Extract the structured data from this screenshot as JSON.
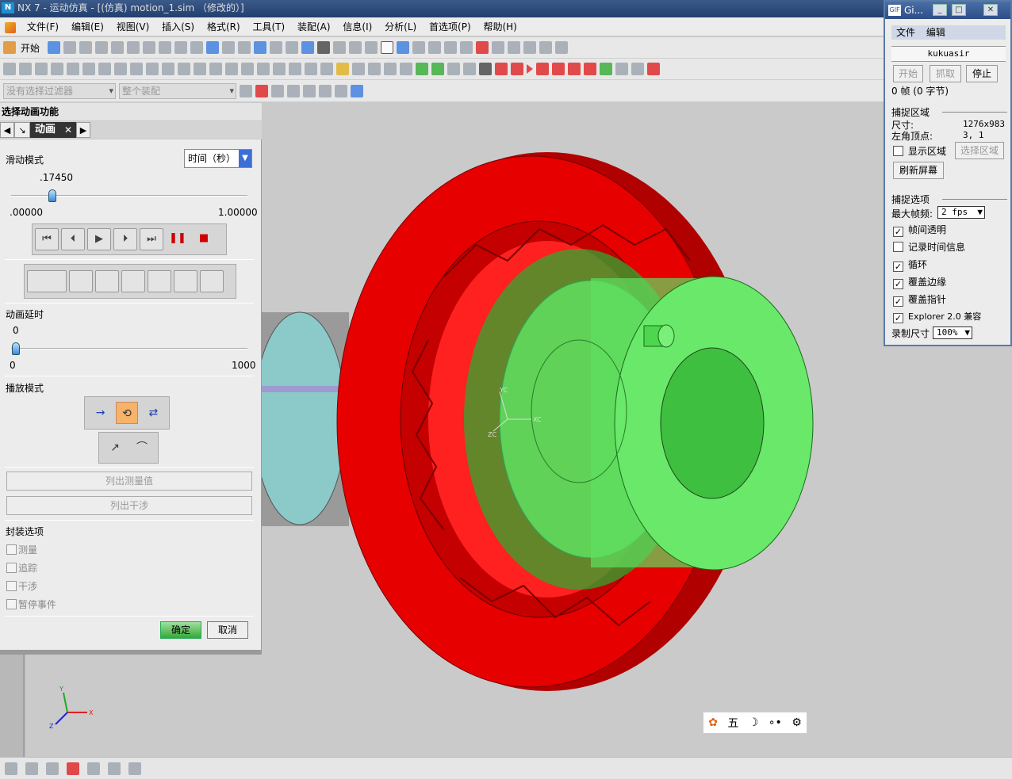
{
  "window": {
    "title": "NX 7 - 运动仿真 - [(仿真) motion_1.sim （修改的）]"
  },
  "menu": [
    "文件(F)",
    "编辑(E)",
    "视图(V)",
    "插入(S)",
    "格式(R)",
    "工具(T)",
    "装配(A)",
    "信息(I)",
    "分析(L)",
    "首选项(P)",
    "帮助(H)"
  ],
  "toolbar": {
    "start_label": "开始",
    "filter_placeholder": "没有选择过滤器",
    "assembly_placeholder": "整个装配"
  },
  "dialog": {
    "title": "选择动画功能",
    "tab_label": "动画",
    "slide_mode_label": "滑动模式",
    "slide_mode_value": "时间（秒）",
    "slider_value": ".17450",
    "slider_min": ".00000",
    "slider_max": "1.00000",
    "slider_fraction": 0.1745,
    "delay_label": "动画延时",
    "delay_value": "0",
    "delay_min": "0",
    "delay_max": "1000",
    "play_mode_label": "播放模式",
    "list_measure_label": "列出测量值",
    "list_interference_label": "列出干涉",
    "package_options_label": "封装选项",
    "package_options": [
      "测量",
      "追踪",
      "干涉",
      "暂停事件"
    ],
    "ok_label": "确定",
    "cancel_label": "取消"
  },
  "gif_recorder": {
    "title": "Gi...",
    "menu": [
      "文件",
      "编辑"
    ],
    "name": "kukuasir",
    "start_label": "开始",
    "grab_label": "抓取",
    "stop_label": "停止",
    "frames_text": "0 帧 (0 字节)",
    "capture_area_label": "捕捉区域",
    "size_label": "尺寸:",
    "size_value": "1276x983",
    "corner_label": "左角顶点:",
    "corner_value": "3, 1",
    "show_area_label": "显示区域",
    "select_area_label": "选择区域",
    "refresh_label": "刷新屏幕",
    "capture_options_label": "捕捉选项",
    "max_fps_label": "最大帧频:",
    "max_fps_value": "2 fps",
    "options": [
      {
        "label": "帧间透明",
        "checked": true
      },
      {
        "label": "记录时间信息",
        "checked": false
      },
      {
        "label": "循环",
        "checked": true
      },
      {
        "label": "覆盖边缘",
        "checked": true
      },
      {
        "label": "覆盖指针",
        "checked": true
      },
      {
        "label": "Explorer 2.0 兼容",
        "checked": true
      }
    ],
    "record_size_label": "录制尺寸",
    "record_size_value": "100%"
  },
  "triad": {
    "x": "X",
    "y": "Y",
    "z": "Z"
  },
  "csys_labels": {
    "xc": "XC",
    "yc": "YC",
    "zc": "ZC"
  },
  "tray_icons": [
    "paw-icon",
    "wu-char-icon",
    "moon-icon",
    "dots-icon",
    "gear-icon"
  ],
  "tray_wu": "五",
  "colors": {
    "gear_red": "#e60000",
    "gear_green": "#5fe05f",
    "shaft_teal": "#8ccaca",
    "highlight_orange": "#f6b36a"
  }
}
